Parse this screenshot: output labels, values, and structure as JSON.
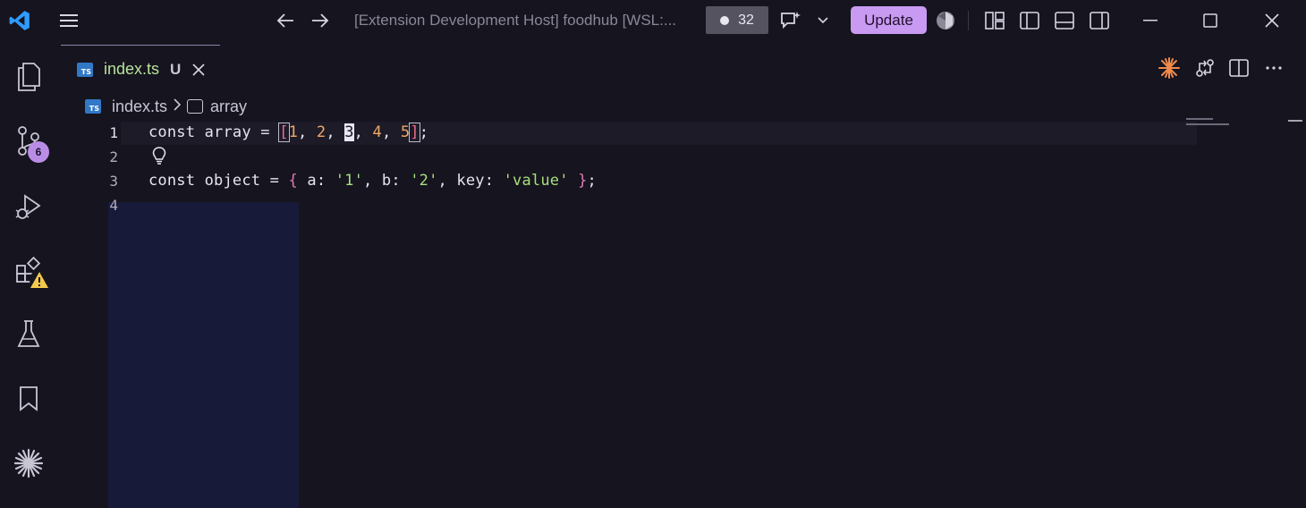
{
  "titlebar": {
    "title": "[Extension Development Host] foodhub [WSL:...",
    "count": "32",
    "update_label": "Update"
  },
  "activity": {
    "scm_badge": "6"
  },
  "tab": {
    "label": "index.ts",
    "status": "U",
    "icon_text": "TS"
  },
  "breadcrumb": {
    "file": "index.ts",
    "symbol": "array"
  },
  "editor": {
    "line_numbers": [
      "1",
      "2",
      "3",
      "4"
    ]
  },
  "colors": {
    "accent": "#c89af2",
    "background": "#16141f",
    "ts_blue": "#3178c6",
    "string": "#a7df7f",
    "number": "#f0a868"
  },
  "icons": [
    "vscode-logo-icon",
    "menu-icon",
    "arrow-left-icon",
    "arrow-right-icon",
    "copilot-chat-icon",
    "chevron-down-icon",
    "account-icon",
    "layout-icon",
    "toggle-sidebar-icon",
    "toggle-panel-icon",
    "toggle-secondary-sidebar-icon",
    "minimize-icon",
    "maximize-icon",
    "close-icon",
    "explorer-icon",
    "source-control-icon",
    "run-debug-icon",
    "extensions-icon",
    "testing-icon",
    "bookmark-icon",
    "sparkle-icon",
    "compare-icon",
    "split-editor-icon",
    "more-actions-icon",
    "lightbulb-icon"
  ]
}
